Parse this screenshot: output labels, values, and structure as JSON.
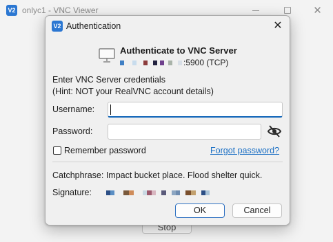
{
  "background_window": {
    "title": "onlyc1 - VNC Viewer",
    "app_icon": "vnc-viewer-icon",
    "stop_label": "Stop"
  },
  "dialog": {
    "title": "Authentication",
    "app_icon": "vnc-viewer-icon",
    "heading": "Authenticate to VNC Server",
    "server_port": ":5900 (TCP)",
    "credentials_line1": "Enter VNC Server credentials",
    "credentials_line2": "(Hint: NOT your RealVNC account details)",
    "username_label": "Username:",
    "username_value": "",
    "password_label": "Password:",
    "password_value": "",
    "remember_label": "Remember password",
    "remember_checked": false,
    "forgot_label": "Forgot password?",
    "catchphrase_text": "Catchphrase: Impact bucket place. Flood shelter quick.",
    "signature_label": "Signature:",
    "ok_label": "OK",
    "cancel_label": "Cancel"
  },
  "colors": {
    "accent": "#0e63b8",
    "link": "#1a6fc4",
    "app_icon": "#2b77d2"
  },
  "redacted_ip_colors": [
    "#3f7fc4",
    "#c8dced",
    "#8c3c3c",
    "#22223f",
    "#6e3f8c",
    "#a9b3a9",
    "#d8dfe7"
  ],
  "signature_colors": [
    "#2c4f86",
    "#5b8fc4",
    "#7a5a3c",
    "#cf8c5a",
    "#c9d9e3",
    "#9c5a6e",
    "#d8b6c0",
    "#5a5a7a",
    "#8ca6c2",
    "#6e8cb0",
    "#7a4f2c",
    "#c2a06e",
    "#2c4f86",
    "#a9c3d8"
  ]
}
